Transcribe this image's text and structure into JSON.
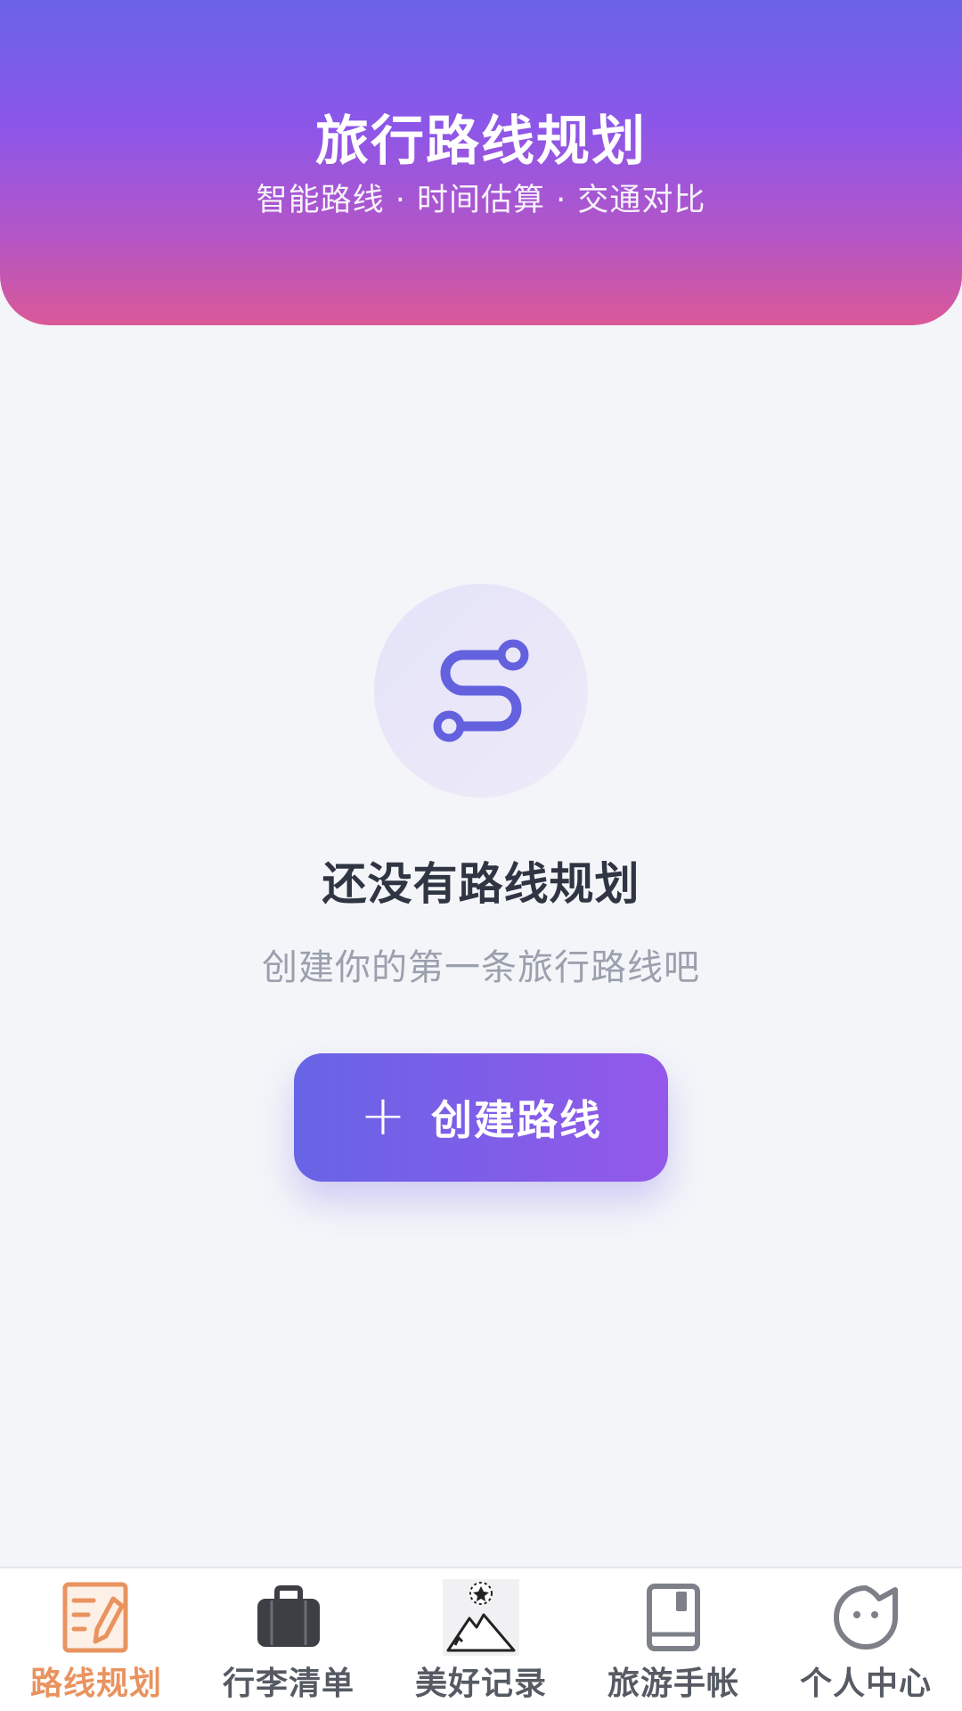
{
  "header": {
    "title": "旅行路线规划",
    "subtitle": "智能路线 · 时间估算 · 交通对比"
  },
  "empty_state": {
    "icon": "route-icon",
    "title": "还没有路线规划",
    "subtitle": "创建你的第一条旅行路线吧",
    "button_plus": "+",
    "button_label": "创建路线"
  },
  "tabbar": {
    "tabs": [
      {
        "label": "路线规划",
        "icon": "route-plan-icon",
        "active": true
      },
      {
        "label": "行李清单",
        "icon": "luggage-icon",
        "active": false
      },
      {
        "label": "美好记录",
        "icon": "mountain-star-icon",
        "active": false
      },
      {
        "label": "旅游手帐",
        "icon": "notebook-icon",
        "active": false
      },
      {
        "label": "个人中心",
        "icon": "profile-icon",
        "active": false
      }
    ]
  },
  "colors": {
    "accent": "#6a63e8",
    "active_tab": "#e9935f",
    "inactive_tab": "#555a63",
    "background": "#f4f5f9"
  }
}
